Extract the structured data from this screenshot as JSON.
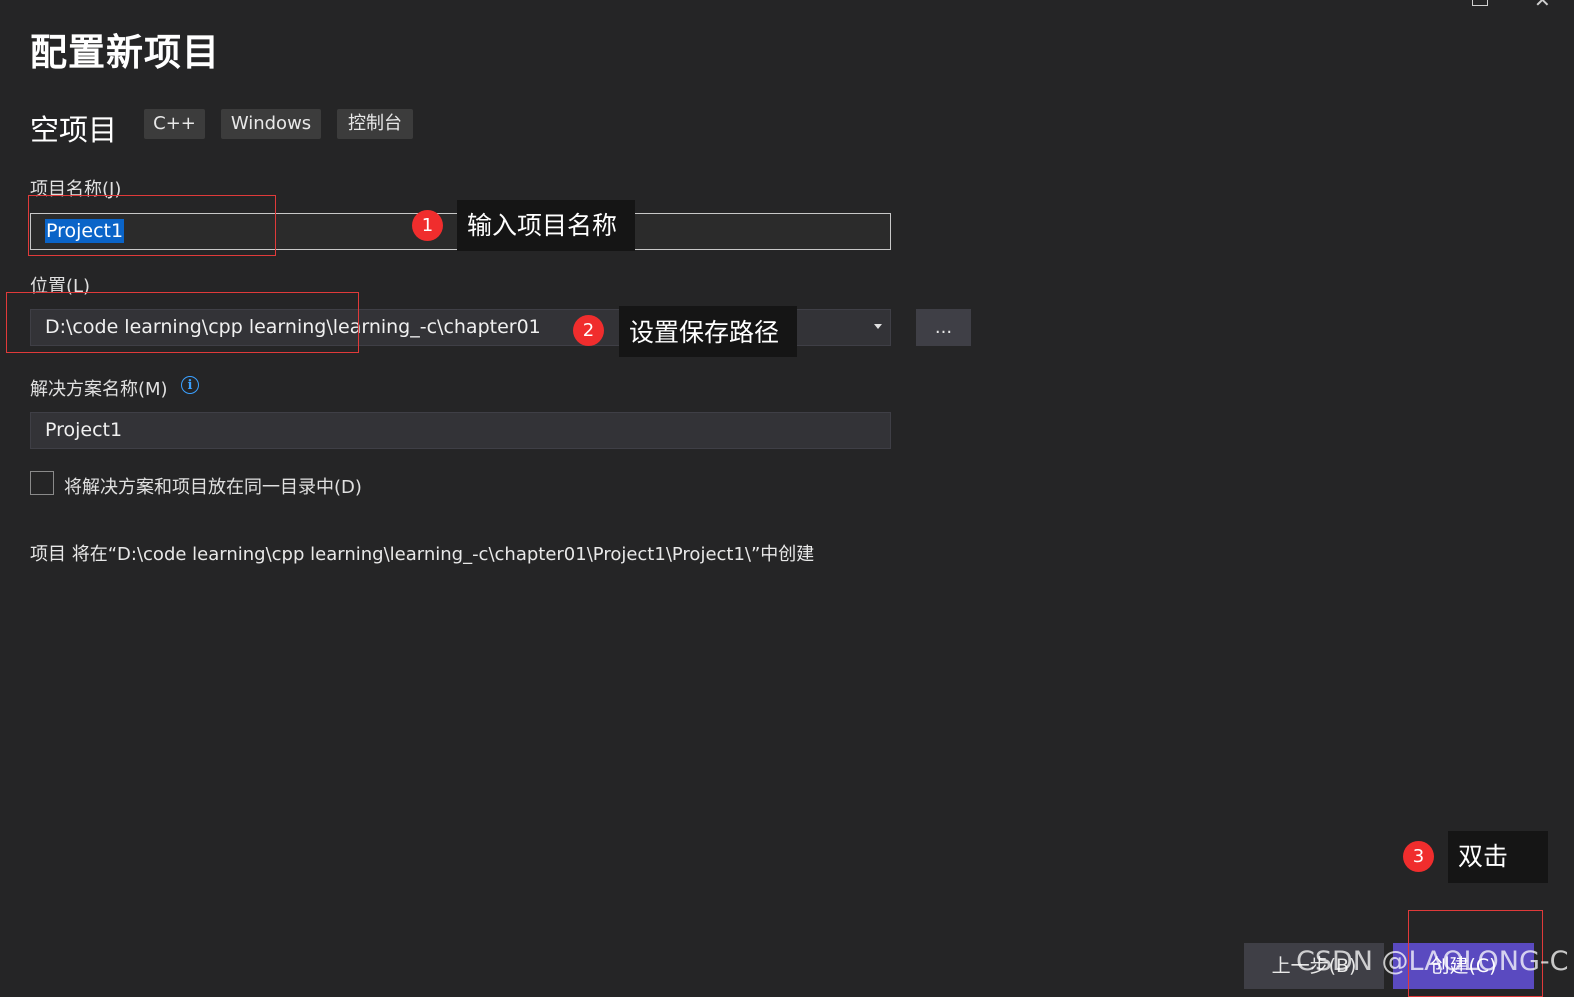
{
  "window": {
    "maximize_icon": "maximize-icon",
    "close_icon": "close-icon",
    "close_glyph": "✕"
  },
  "header": {
    "title": "配置新项目",
    "template_name": "空项目",
    "tags": [
      "C++",
      "Windows",
      "控制台"
    ]
  },
  "form": {
    "project_name": {
      "label": "项目名称(J)",
      "value": "Project1"
    },
    "location": {
      "label": "位置(L)",
      "value": "D:\\code learning\\cpp learning\\learning_-c\\chapter01",
      "browse_label": "..."
    },
    "solution_name": {
      "label": "解决方案名称(M)",
      "value": "Project1",
      "info_glyph": "i"
    },
    "same_directory": {
      "label": "将解决方案和项目放在同一目录中(D)",
      "checked": false
    },
    "creation_path_text": "项目 将在“D:\\code learning\\cpp learning\\learning_-c\\chapter01\\Project1\\Project1\\”中创建"
  },
  "annotations": [
    {
      "number": "1",
      "text": "输入项目名称"
    },
    {
      "number": "2",
      "text": "设置保存路径"
    },
    {
      "number": "3",
      "text": "双击"
    }
  ],
  "footer": {
    "back_label": "上一步(B)",
    "create_label": "创建(C)"
  },
  "watermark": "CSDN @LAOLONG-C",
  "colors": {
    "background": "#252526",
    "accent_button": "#5a4ac0",
    "annotation_red": "#f02d2d",
    "selection_blue": "#0a64c8"
  }
}
